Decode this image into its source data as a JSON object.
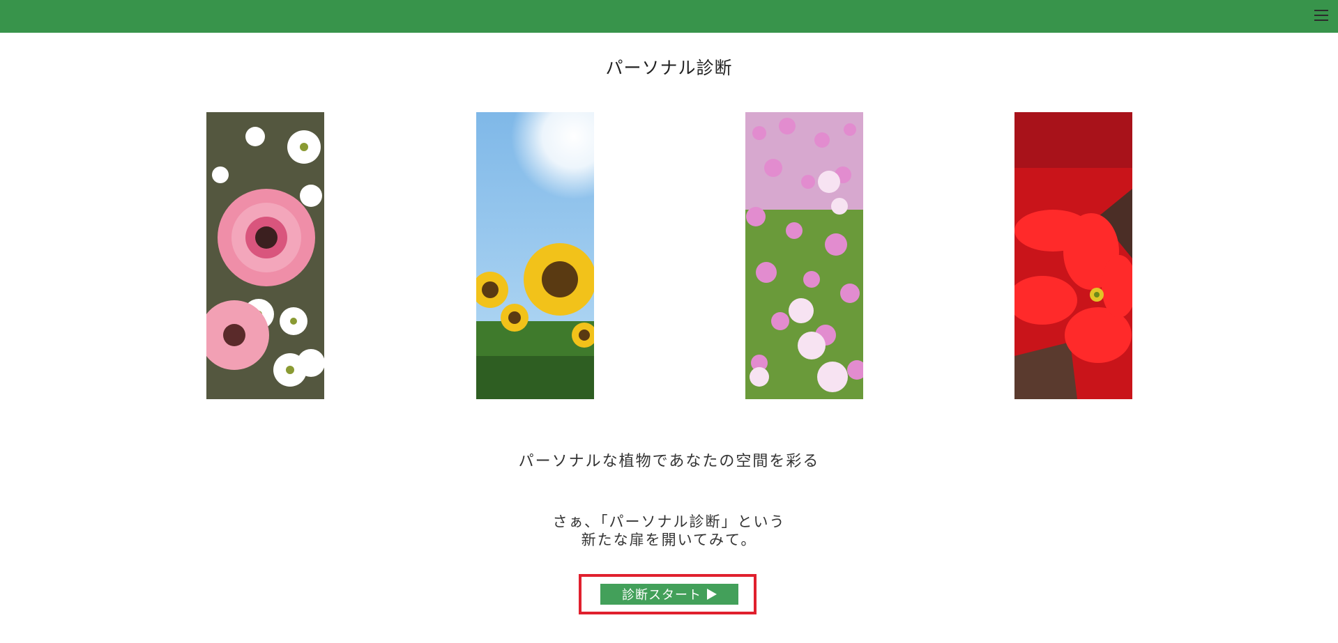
{
  "header": {
    "menu_icon": "hamburger-menu-icon",
    "bar_color": "#38944b"
  },
  "page": {
    "title": "パーソナル診断",
    "tagline": "パーソナルな植物であなたの空間を彩る",
    "invite_line1": "さぁ、「パーソナル診断」という",
    "invite_line2": "新たな扉を開いてみて。"
  },
  "gallery": {
    "images": [
      {
        "subject": "pink gerbera and white daisies"
      },
      {
        "subject": "sunflowers under blue sky"
      },
      {
        "subject": "pink cosmos field"
      },
      {
        "subject": "red poinsettia"
      }
    ]
  },
  "cta": {
    "label": "診断スタート",
    "icon": "play-icon",
    "button_color": "#43a05a",
    "highlight_color": "#e0202e"
  }
}
